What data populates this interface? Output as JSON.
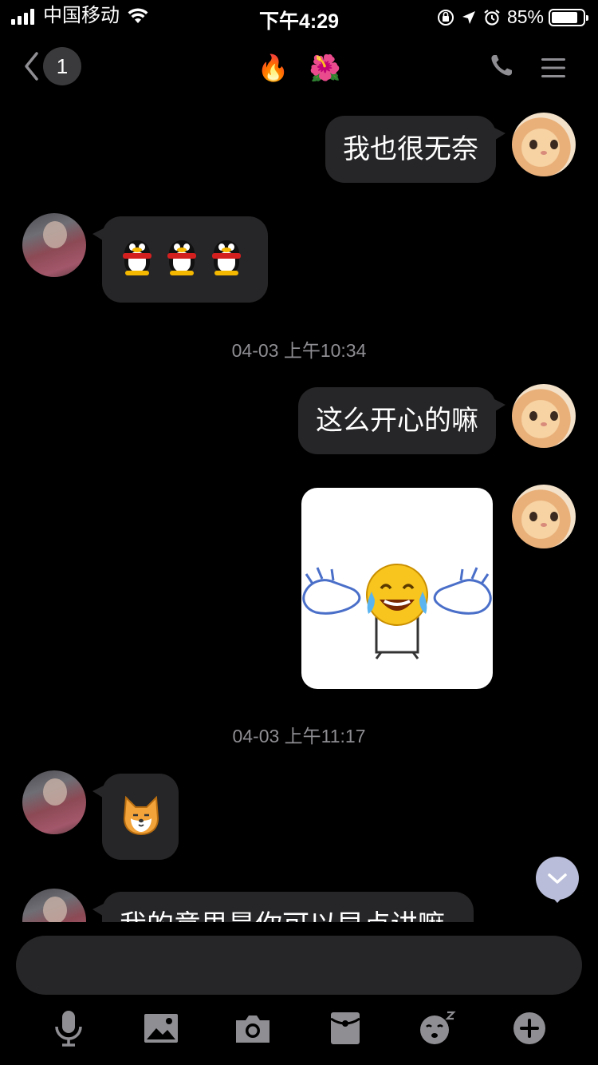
{
  "status_bar": {
    "carrier": "中国移动",
    "time": "下午4:29",
    "battery": "85%",
    "battery_level": 0.85
  },
  "nav": {
    "back_badge": "1",
    "title_emojis": [
      "🔥",
      "🌺"
    ]
  },
  "messages": [
    {
      "side": "out",
      "type": "text",
      "text": "我也很无奈"
    },
    {
      "side": "in",
      "type": "emoji",
      "emojis": [
        "qq-penguin",
        "qq-penguin",
        "qq-penguin"
      ]
    },
    {
      "type": "timestamp",
      "text": "04-03 上午10:34"
    },
    {
      "side": "out",
      "type": "text",
      "text": "这么开心的嘛"
    },
    {
      "side": "out",
      "type": "sticker",
      "sticker": "laughing-tears-clapping-hands"
    },
    {
      "type": "timestamp",
      "text": "04-03 上午11:17"
    },
    {
      "side": "in",
      "type": "emoji",
      "emojis": [
        "shiba-face"
      ]
    },
    {
      "side": "in",
      "type": "text",
      "text": "我的意思是你可以早点讲嘛"
    }
  ],
  "input": {
    "placeholder": "",
    "value": ""
  },
  "toolbar": [
    "microphone-icon",
    "image-icon",
    "camera-icon",
    "red-packet-icon",
    "emoji-icon",
    "plus-icon"
  ]
}
